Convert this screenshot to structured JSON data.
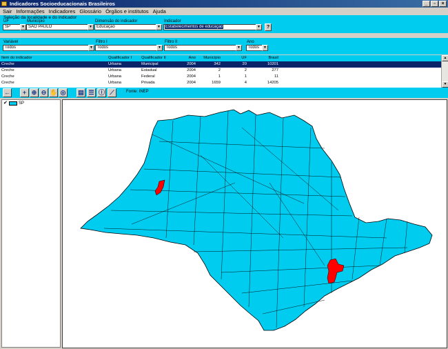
{
  "window": {
    "title": "Indicadores Socioeducacionais Brasileiros",
    "controls": [
      "_",
      "▫",
      "×"
    ]
  },
  "menu": [
    "Sair",
    "Informações",
    "Indicadores",
    "Glossário",
    "Órgãos e institutos",
    "Ajuda"
  ],
  "selection": {
    "legend": "Seleção da localidade e do indicador",
    "uf": {
      "label": "UF",
      "value": "SP"
    },
    "municipio": {
      "label": "Município",
      "value": "SAO PAULO"
    },
    "dimensao": {
      "label": "Dimensão do indicador",
      "value": "Educação"
    },
    "indicador": {
      "label": "Indicador",
      "value": "Estabelecimentos de educação"
    },
    "help": "?"
  },
  "filters": {
    "variavel": {
      "label": "Variável",
      "value": "Todos"
    },
    "filtro1": {
      "label": "Filtro I",
      "value": "Todos"
    },
    "filtro2": {
      "label": "Filtro II",
      "value": "Todos"
    },
    "ano": {
      "label": "Ano",
      "value": "Todos"
    }
  },
  "table": {
    "headers": [
      "Item do indicador",
      "Qualificador I",
      "Qualificador II",
      "Ano",
      "Município",
      "UF",
      "Brasil"
    ],
    "rows": [
      [
        "Creche",
        "Urbana",
        "Municipal",
        "2004",
        "342",
        "20",
        "10201"
      ],
      [
        "Creche",
        "Urbana",
        "Estadual",
        "2004",
        "2",
        "2",
        "277"
      ],
      [
        "Creche",
        "Urbana",
        "Federal",
        "2004",
        "1",
        "1",
        "11"
      ],
      [
        "Creche",
        "Urbana",
        "Privada",
        "2004",
        "1659",
        "4",
        "14205"
      ]
    ]
  },
  "toolbar": {
    "fonte": "Fonte: INEP"
  },
  "layers": [
    {
      "name": "SP",
      "color": "#00ccf0"
    }
  ],
  "map": {
    "fill": "#00ccf0",
    "highlight": "#ff0000"
  }
}
